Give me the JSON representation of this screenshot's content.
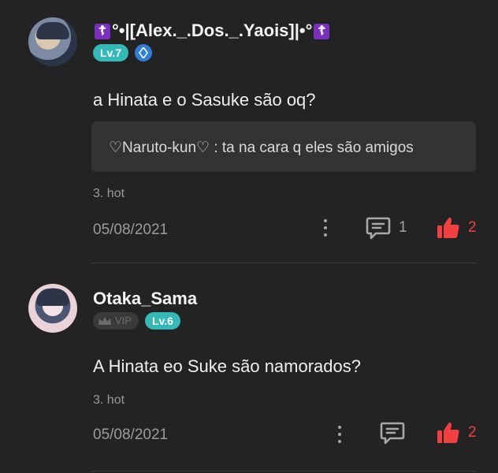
{
  "comments": [
    {
      "username_parts": [
        "°•|[Alex._.Dos._.Yaois]|•°"
      ],
      "username_decoration": "☦",
      "level": "Lv.7",
      "text": "a Hinata e o Sasuke são oq?",
      "reply_preview": "♡Naruto-kun♡ : ta na cara q eles são amigos",
      "hot": "3. hot",
      "date": "05/08/2021",
      "reply_count": "1",
      "like_count": "2",
      "icons": [
        "avatar",
        "verified-badge-icon",
        "more-icon",
        "reply-icon",
        "like-icon"
      ]
    },
    {
      "username": "Otaka_Sama",
      "vip": "VIP",
      "level": "Lv.6",
      "text": "A Hinata eo Suke são namorados?",
      "hot": "3. hot",
      "date": "05/08/2021",
      "like_count": "2",
      "icons": [
        "avatar",
        "crown-icon",
        "more-icon",
        "reply-icon",
        "like-icon"
      ]
    }
  ],
  "colors": {
    "background": "#232323",
    "level_badge": "#35b8b8",
    "like": "#f04040",
    "reply_box": "#333333"
  }
}
